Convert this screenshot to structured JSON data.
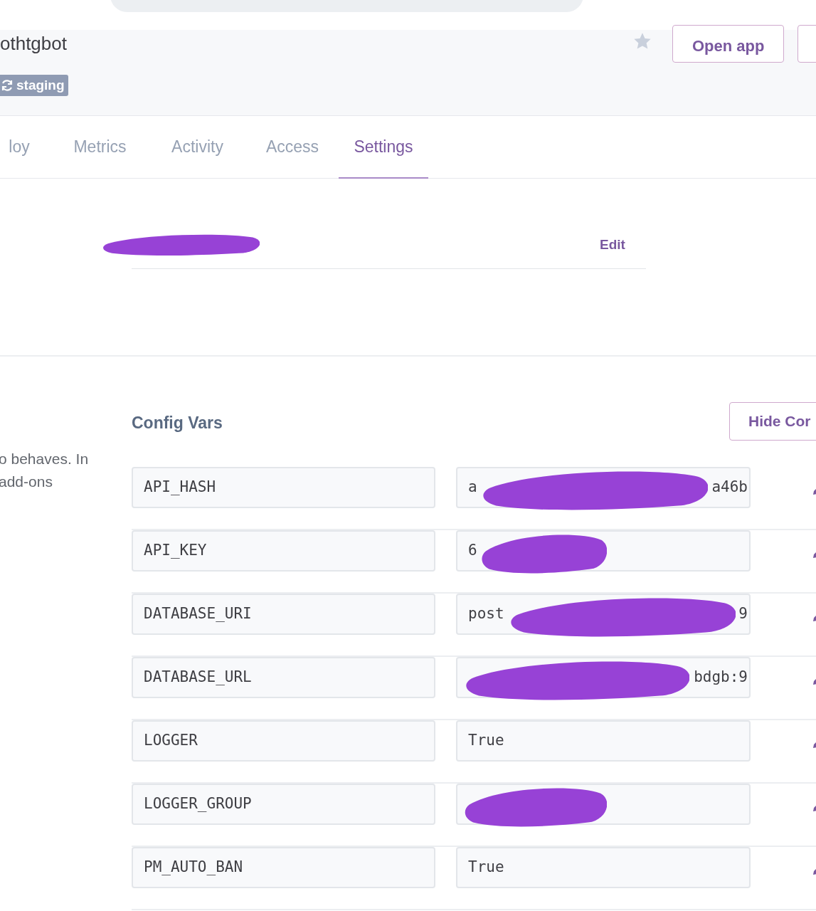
{
  "app": {
    "name": "othtgbot",
    "badge": "staging",
    "starred": false,
    "buttons": [
      "Open app"
    ]
  },
  "tabs": [
    {
      "label": "loy",
      "selected": false
    },
    {
      "label": "Metrics",
      "selected": false
    },
    {
      "label": "Activity",
      "selected": false
    },
    {
      "label": "Access",
      "selected": false
    },
    {
      "label": "Settings",
      "selected": true
    }
  ],
  "info_section": {
    "name_redacted": true,
    "edit_link": "Edit"
  },
  "config_vars": {
    "description_lines": [
      "o behaves. In",
      "add-ons"
    ],
    "title": "Config Vars",
    "hide_button": "Hide Cor",
    "rows": [
      {
        "key": "API_HASH",
        "value_start": "a",
        "value_end": "a46b",
        "redacted": true
      },
      {
        "key": "API_KEY",
        "value_start": "6",
        "redacted": true
      },
      {
        "key": "DATABASE_URI",
        "value_start": "post",
        "value_end": "9",
        "redacted": true
      },
      {
        "key": "DATABASE_URL",
        "value_end": "bdgb:9",
        "redacted": true
      },
      {
        "key": "LOGGER",
        "value_start": "True",
        "redacted": false
      },
      {
        "key": "LOGGER_GROUP",
        "redacted": true
      },
      {
        "key": "PM_AUTO_BAN",
        "value_start": "True",
        "redacted": false
      }
    ]
  }
}
